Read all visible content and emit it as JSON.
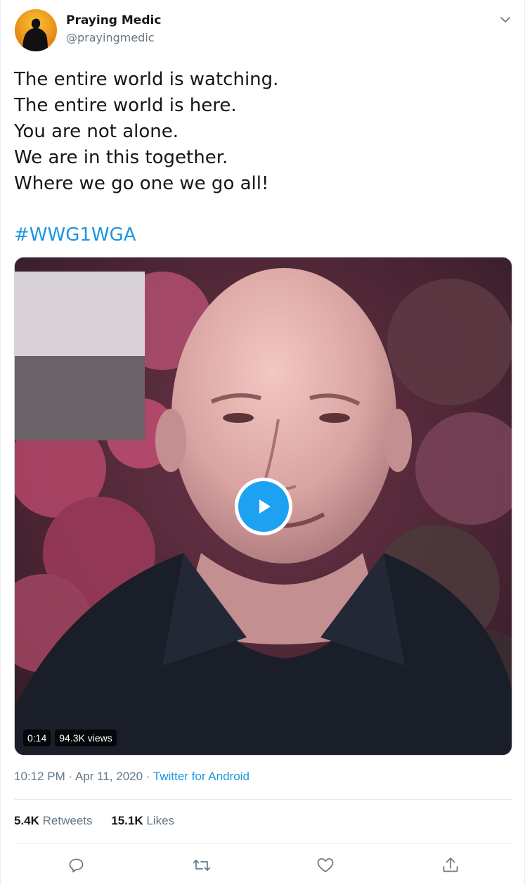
{
  "author": {
    "display_name": "Praying Medic",
    "handle": "@prayingmedic"
  },
  "tweet": {
    "lines": [
      "The entire world is watching.",
      "The entire world is here.",
      "You are not alone.",
      "We are in this together.",
      "Where we go one we go all!"
    ],
    "hashtag": "#WWG1WGA"
  },
  "video": {
    "duration": "0:14",
    "views": "94.3K views"
  },
  "meta": {
    "time": "10:12 PM",
    "separator": "·",
    "date": "Apr 11, 2020",
    "source": "Twitter for Android"
  },
  "stats": {
    "retweets_count": "5.4K",
    "retweets_label": "Retweets",
    "likes_count": "15.1K",
    "likes_label": "Likes"
  },
  "icons": {
    "more": "chevron-down-icon",
    "reply": "reply-icon",
    "retweet": "retweet-icon",
    "like": "heart-icon",
    "share": "share-icon",
    "play": "play-icon"
  },
  "colors": {
    "accent": "#1da1f2",
    "link": "#1b95e0",
    "text": "#14171a",
    "secondary": "#657786",
    "border": "#e6ecf0"
  }
}
